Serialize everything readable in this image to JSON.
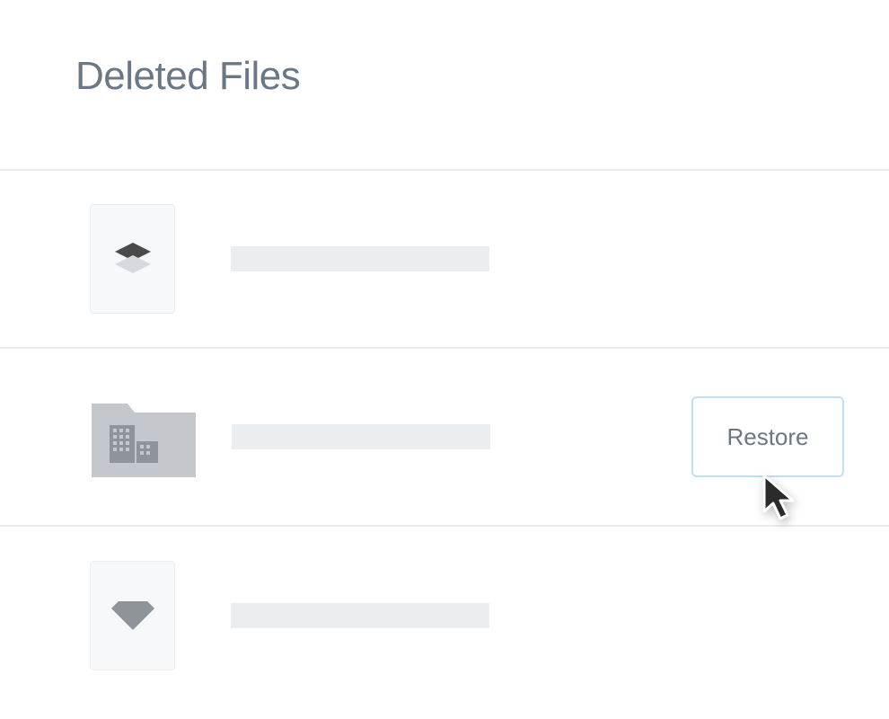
{
  "page_title": "Deleted Files",
  "rows": [
    {
      "icon": "layers",
      "type": "file",
      "has_restore": false
    },
    {
      "icon": "folder-building",
      "type": "folder",
      "has_restore": true
    },
    {
      "icon": "diamond",
      "type": "file",
      "has_restore": false
    }
  ],
  "restore_label": "Restore"
}
